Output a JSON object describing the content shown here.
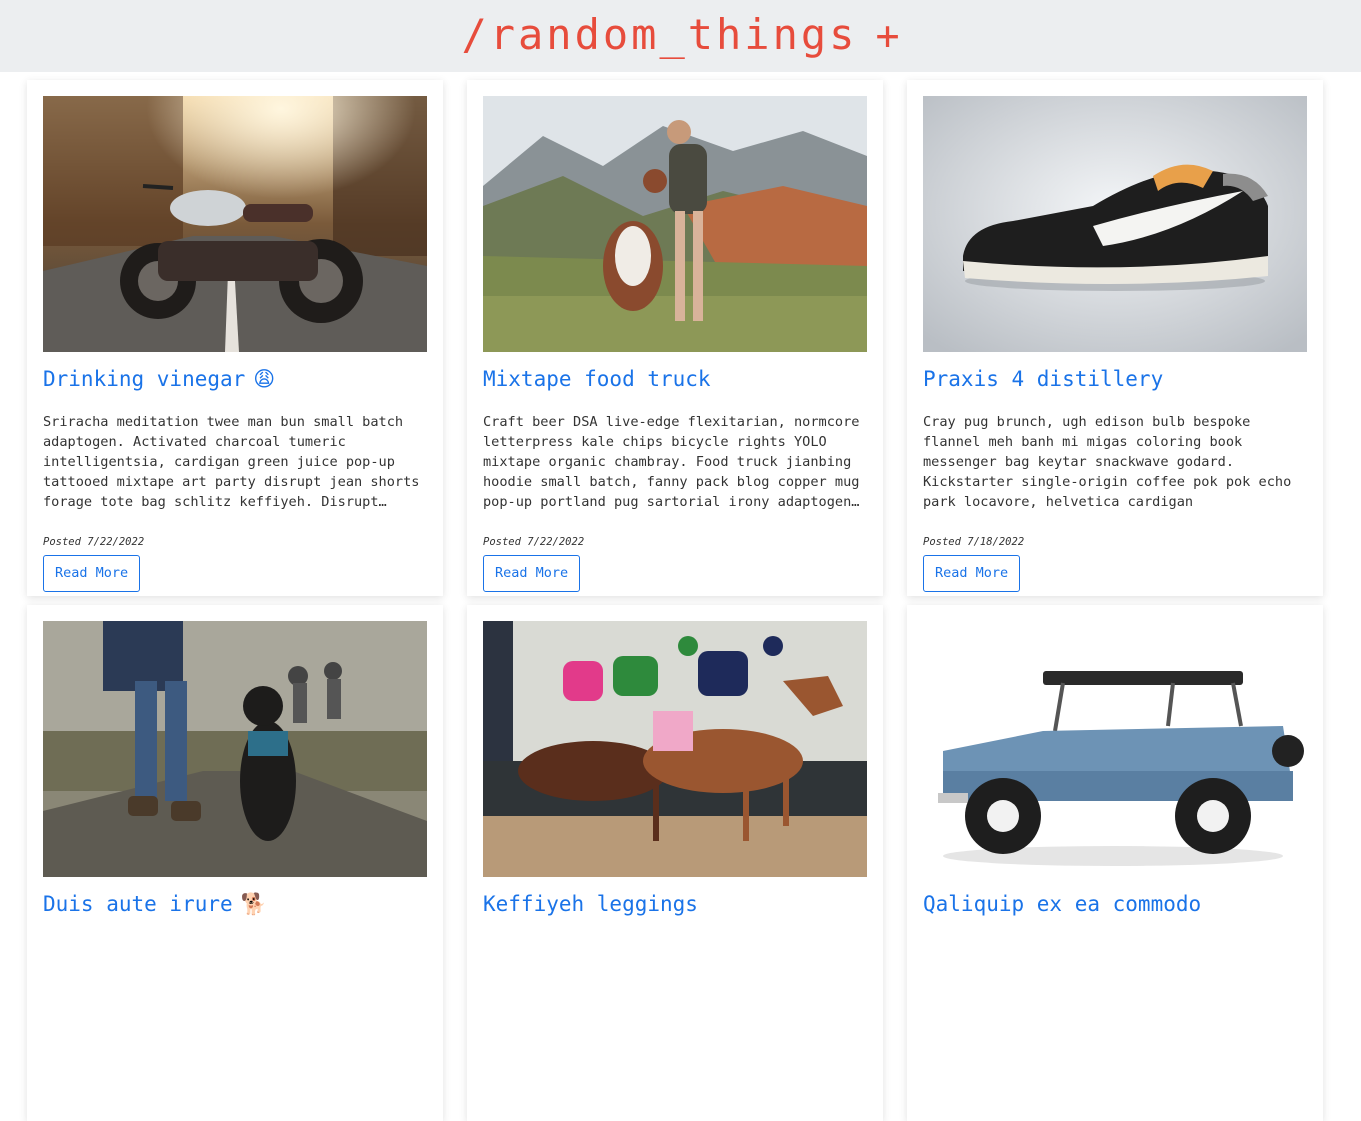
{
  "header": {
    "title": "/random_things",
    "add_label": "+"
  },
  "colors": {
    "accent": "#e74c3c",
    "link": "#1a73e8",
    "header_bg": "#eceef0"
  },
  "posts": [
    {
      "image": "motorcycle-photo",
      "title": "Drinking vinegar",
      "emoji": "😩",
      "excerpt": "Sriracha meditation twee man bun small batch adaptogen. Activated charcoal tumeric intelligentsia, cardigan green juice pop-up tattooed mixtape art party disrupt jean shorts forage tote bag schlitz keffiyeh. Disrupt…",
      "posted": "Posted 7/22/2022",
      "button": "Read More"
    },
    {
      "image": "woman-and-dog-mountain-photo",
      "title": "Mixtape food truck",
      "emoji": "",
      "excerpt": "Craft beer DSA live-edge flexitarian, normcore letterpress kale chips bicycle rights YOLO mixtape organic chambray. Food truck jianbing hoodie small batch, fanny pack blog copper mug pop-up portland pug sartorial irony adaptogen…",
      "posted": "Posted 7/22/2022",
      "button": "Read More"
    },
    {
      "image": "sneaker-photo",
      "title": "Praxis 4 distillery",
      "emoji": "",
      "excerpt": "Cray pug brunch, ugh edison bulb bespoke flannel meh banh mi migas coloring book messenger bag keytar snackwave godard. Kickstarter single-origin coffee pok pok echo park locavore, helvetica cardigan intelligentsia af lo-fi tru…",
      "posted": "Posted 7/18/2022",
      "button": "Read More"
    },
    {
      "image": "dog-walk-photo",
      "title": "Duis aute irure",
      "emoji": "🐕",
      "excerpt": "",
      "posted": "",
      "button": ""
    },
    {
      "image": "horse-race-photo",
      "title": "Keffiyeh leggings",
      "emoji": "",
      "excerpt": "",
      "posted": "",
      "button": ""
    },
    {
      "image": "vintage-truck-photo",
      "title": "Qaliquip ex ea commodo",
      "emoji": "",
      "excerpt": "",
      "posted": "",
      "button": ""
    }
  ]
}
